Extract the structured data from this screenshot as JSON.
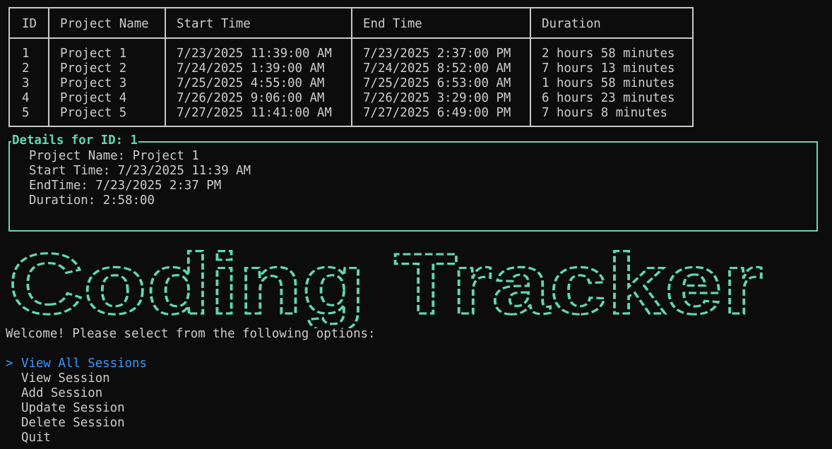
{
  "table": {
    "headers": [
      "ID",
      "Project Name",
      "Start Time",
      "End Time",
      "Duration"
    ],
    "rows": [
      [
        "1",
        "Project 1",
        "7/23/2025 11:39:00 AM",
        "7/23/2025 2:37:00 PM",
        "2 hours 58 minutes"
      ],
      [
        "2",
        "Project 2",
        "7/24/2025 1:39:00 AM",
        "7/24/2025 8:52:00 AM",
        "7 hours 13 minutes"
      ],
      [
        "3",
        "Project 3",
        "7/25/2025 4:55:00 AM",
        "7/25/2025 6:53:00 AM",
        "1 hours 58 minutes"
      ],
      [
        "4",
        "Project 4",
        "7/26/2025 9:06:00 AM",
        "7/26/2025 3:29:00 PM",
        "6 hours 23 minutes"
      ],
      [
        "5",
        "Project 5",
        "7/27/2025 11:41:00 AM",
        "7/27/2025 6:49:00 PM",
        "7 hours 8 minutes"
      ]
    ]
  },
  "details": {
    "title": "Details for ID: 1",
    "lines": [
      "Project Name: Project 1",
      "Start Time: 7/23/2025 11:39 AM",
      "EndTime: 7/23/2025 2:37 PM",
      "Duration: 2:58:00"
    ]
  },
  "banner": {
    "text": "Coding Tracker",
    "color": "#5fd7af"
  },
  "menu": {
    "prompt": "Welcome! Please select from the following options:",
    "pointer": ">",
    "selected_index": 0,
    "options": [
      "View All Sessions",
      "View Session",
      "Add Session",
      "Update Session",
      "Delete Session",
      "Quit"
    ]
  },
  "colors": {
    "background": "#0c0c0c",
    "text": "#cccccc",
    "accent": "#5fd7af",
    "selected": "#3a96ff",
    "table_border": "#c8c8c8"
  }
}
